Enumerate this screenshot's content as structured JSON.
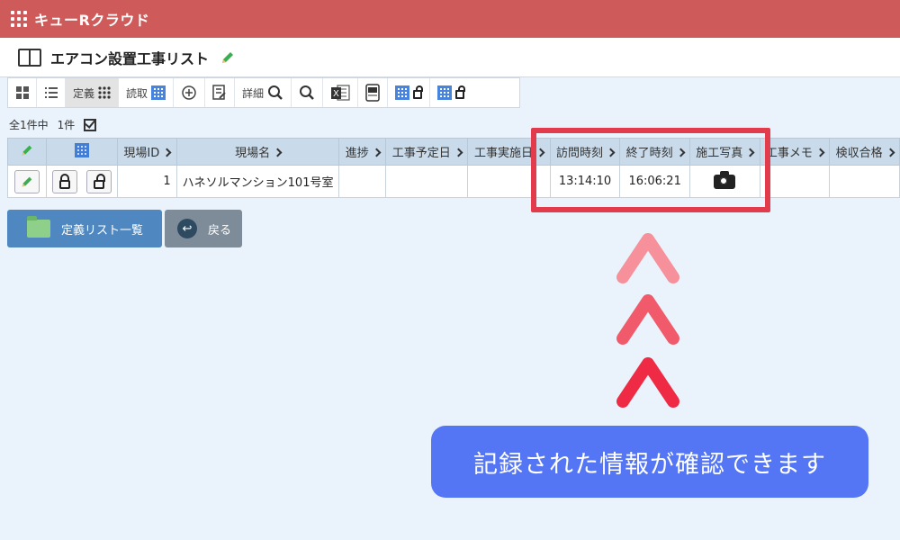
{
  "app": {
    "title": "キューRクラウド"
  },
  "page": {
    "title": "エアコン設置工事リスト"
  },
  "toolbar": {
    "teigi_label": "定義",
    "yomitori_label": "読取",
    "shosai_label": "詳細"
  },
  "summary": {
    "total": "全1件中",
    "selected": "1件"
  },
  "table": {
    "headers": [
      "現場ID",
      "現場名",
      "進捗",
      "工事予定日",
      "工事実施日",
      "訪問時刻",
      "終了時刻",
      "施工写真",
      "工事メモ",
      "検収合格"
    ],
    "rows": [
      {
        "id": "1",
        "name": "ハネソルマンション101号室",
        "progress": "",
        "planned": "",
        "done": "",
        "visit": "13:14:10",
        "end": "16:06:21",
        "photo_icon": "camera-icon",
        "memo": "",
        "accept": ""
      }
    ]
  },
  "buttons": {
    "list_label": "定義リスト一覧",
    "back_label": "戻る"
  },
  "annotation": {
    "message": "記録された情報が確認できます",
    "highlight_color": "#e23b4c",
    "bubble_color": "#5476f5"
  },
  "colors": {
    "topbar": "#cf5a5a",
    "header": "#c9daea",
    "button_primary": "#4f88c0",
    "button_secondary": "#7e8c99"
  }
}
